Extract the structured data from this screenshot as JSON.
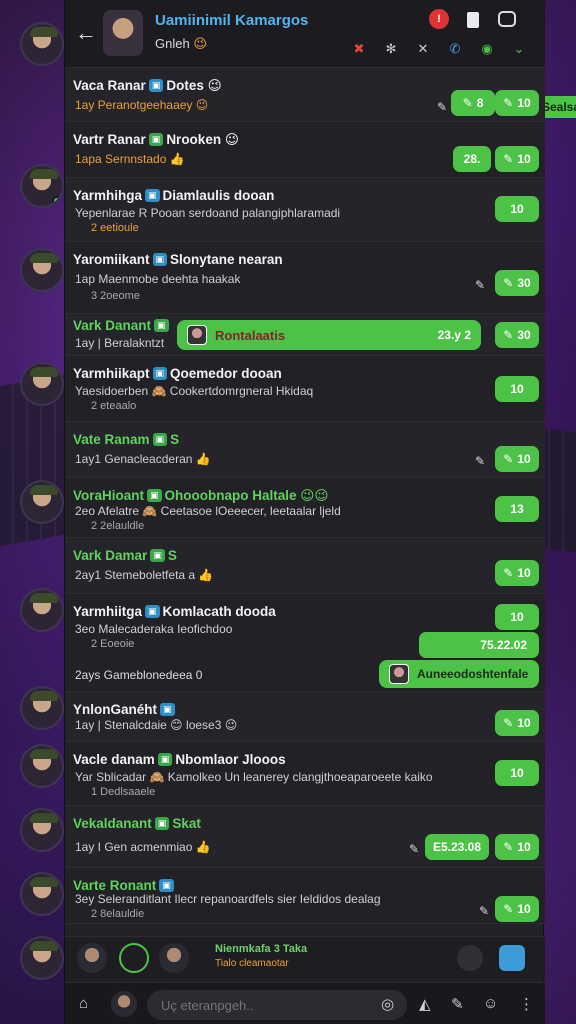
{
  "header": {
    "title": "Uamiinimil Kamargos",
    "subtitle": "Gnleh",
    "subtitle_emoji": "😉",
    "icons": [
      "alert-icon",
      "trash-icon",
      "chat-icon",
      "tool-icon",
      "settings-icon",
      "close-icon",
      "phone-icon",
      "video-icon",
      "chevron-down-icon"
    ]
  },
  "rows": [
    {
      "name": "Vaca Ranar",
      "tag": "▣",
      "title": "Dotes 😉",
      "msg": "1ay Peranotgeehaaey 😉",
      "time": "8",
      "badge": "10"
    },
    {
      "name": "Vartr Ranar",
      "tag": "▣",
      "title": "Nrooken 😉",
      "msg": "1apa Sernnstado 👍",
      "time": "28.",
      "badge": "10"
    },
    {
      "name": "Yarmhihga",
      "tag": "▣",
      "title": "Diamlaulis dooan",
      "msg": "Yepenlarae R Pooan serdoand palangiphlaramadi",
      "meta": "2 eetioule",
      "badge": "10"
    },
    {
      "name": "Yaromiikant",
      "tag": "▣",
      "title": "Slonytane nearan",
      "msg": "1ap Maenmobe deehta haakak",
      "meta": "3 2oeome",
      "badge": "30"
    },
    {
      "name": "Vark Danant",
      "tag": "▣",
      "title": "",
      "msg": "1ay | Beralakntzt",
      "bubble": "Rontalaatis",
      "bubble_time": "23.y 2",
      "badge": "30"
    },
    {
      "name": "Yarmhiikapt",
      "tag": "▣",
      "title": "Qoemedor dooan",
      "msg": "Yaesidoerben 🙈 Cookertdomrgneral Hkidaq",
      "meta": "2 eteaalo",
      "badge": "10"
    },
    {
      "name": "Vate Ranam",
      "tag": "▣",
      "title": "S",
      "msg": "1ay1 Genacleacderan 👍",
      "badge": "10"
    },
    {
      "name": "VoraHioant",
      "tag": "▣",
      "title": "Ohooobnapo Haltale 😉😉",
      "msg": "2eo Afelatre 🙈 Ceetasoe lOeeecer, leetaalar ljeld",
      "meta": "2 2elauldle",
      "badge": "13"
    },
    {
      "name": "Vark Damar",
      "tag": "▣",
      "title": "S",
      "msg": "2ay1 Stemeboletfeta a 👍",
      "badge": "10"
    },
    {
      "name": "Yarmhiitga",
      "tag": "▣",
      "title": "Komlacath dooda",
      "msg": "3eo Malecaderaka Ieofichdoo",
      "meta": "2 Eoeoie",
      "badge": "10",
      "bubble_time": "75.22.02",
      "extra_msg": "2ays Gameblonedeea 0",
      "extra_bubble": "Auneeodoshtenfale"
    },
    {
      "name": "YnlonGanéht",
      "tag": "▣",
      "title": "",
      "msg": "1ay | Stenalcdaie 😊 loese3 😉",
      "badge": "10"
    },
    {
      "name": "Vacle danam",
      "tag": "▣",
      "title": "Nbomlaor Jlooos",
      "msg": "Yar Sblicadar 🙈 Kamolkeo Un leanerey clangjthoeaparoeete kaiko",
      "meta": "1 Dedlsaaele",
      "badge": "10"
    },
    {
      "name": "Vekaldanant",
      "tag": "▣",
      "title": "Skat",
      "msg": "1ay I Gen acmenmiao 👍",
      "time": "E5.23.08",
      "badge": "10"
    },
    {
      "name": "Varte Ronant",
      "tag": "▣",
      "title": "",
      "msg": "3ey Seleranditlant Ilecr repanoardfels sier Ieldidos dealag",
      "meta": "2 8elauldie",
      "badge": "10"
    }
  ],
  "strip": {
    "title": "Nienmkafa 3 Taka",
    "subtitle": "Tialo cleamaotar"
  },
  "compose": {
    "placeholder": "Uç eteranpgeh.."
  },
  "side_right": {
    "pill_text": "Sealsa"
  }
}
